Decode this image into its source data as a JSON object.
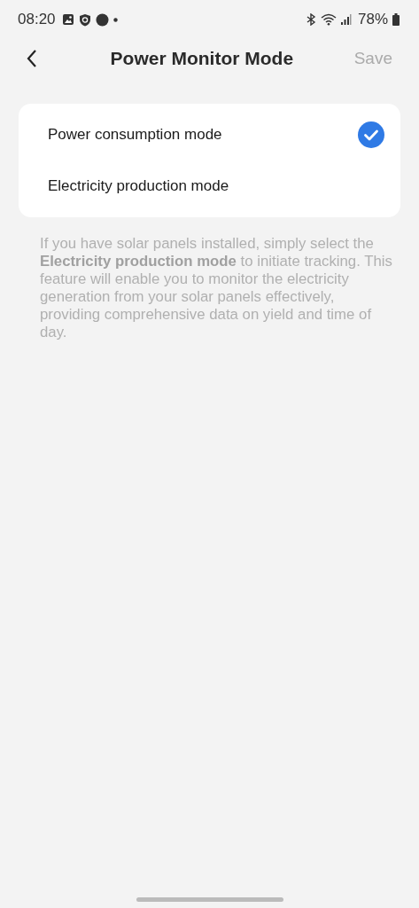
{
  "status_bar": {
    "time": "08:20",
    "battery": "78%"
  },
  "header": {
    "title": "Power Monitor Mode",
    "action": "Save"
  },
  "modes": [
    {
      "label": "Power consumption mode",
      "selected": true
    },
    {
      "label": "Electricity production mode",
      "selected": false
    }
  ],
  "description": "If you have solar panels installed, simply select the **Electricity production mode** to initiate tracking. This feature will enable you to monitor the electricity generation from your solar panels effectively, providing comprehensive data on yield and time of day."
}
